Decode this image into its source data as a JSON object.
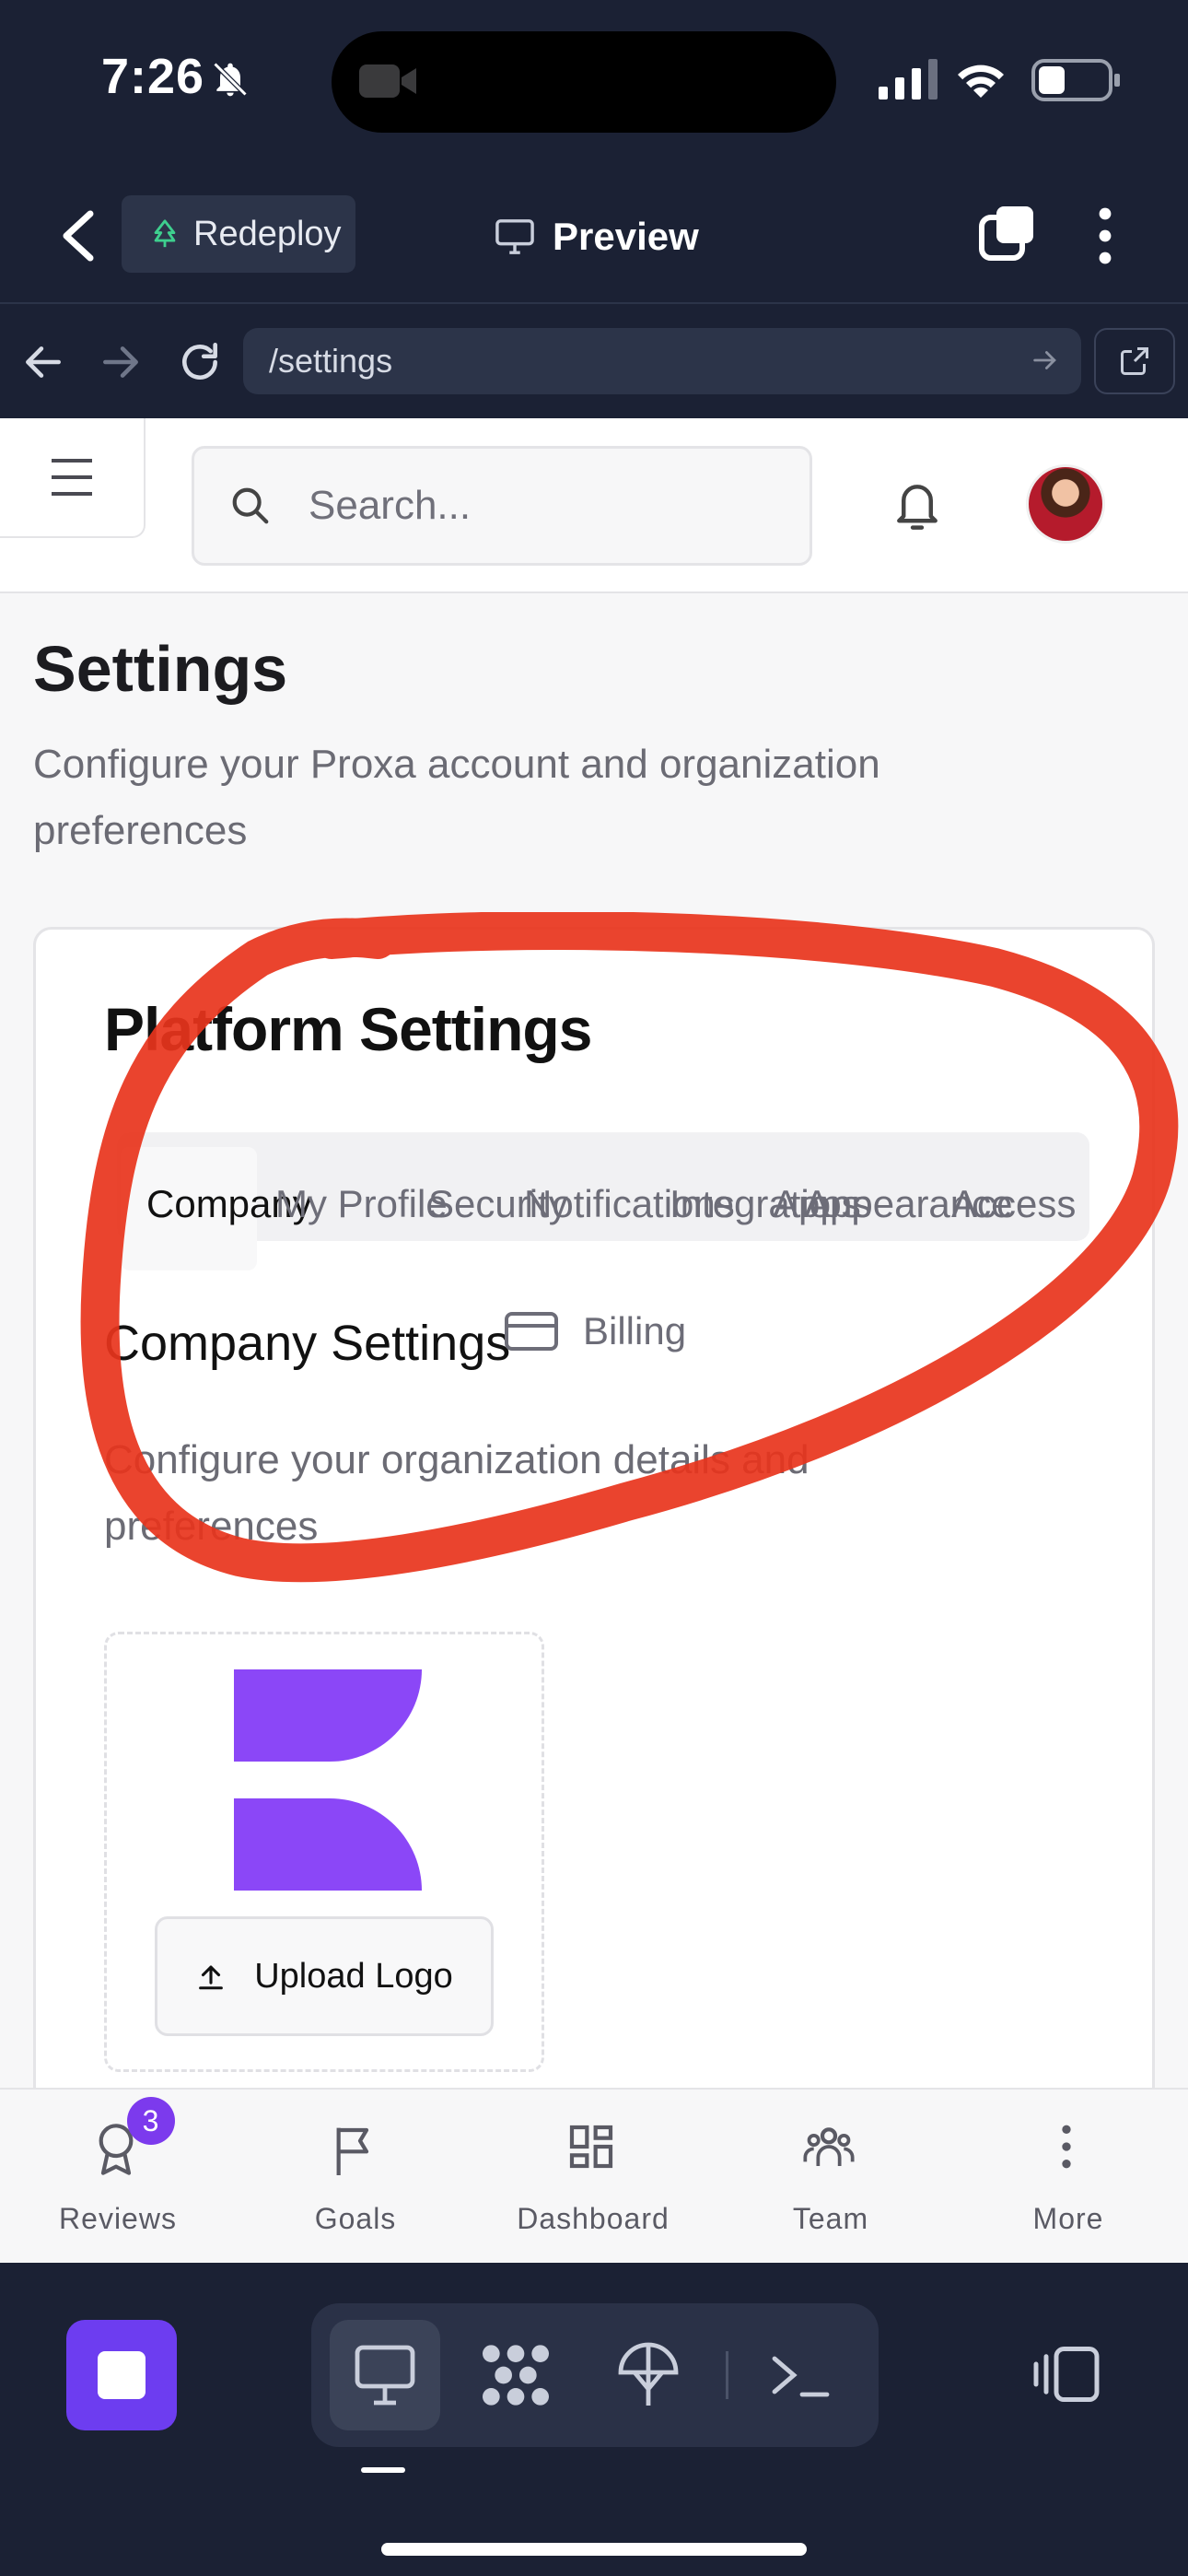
{
  "status_bar": {
    "time": "7:26"
  },
  "app_header": {
    "redeploy_label": "Redeploy",
    "preview_label": "Preview"
  },
  "browser": {
    "url": "/settings"
  },
  "topbar": {
    "search_placeholder": "Search..."
  },
  "page": {
    "title": "Settings",
    "subtitle": "Configure your Proxa account and organization preferences"
  },
  "card": {
    "title": "Platform Settings",
    "tabs": [
      {
        "label": "Company"
      },
      {
        "label": "My Profile"
      },
      {
        "label": "Security"
      },
      {
        "label": "Notifications"
      },
      {
        "label": "Integrations"
      },
      {
        "label": "Apps"
      },
      {
        "label": "Appearance"
      },
      {
        "label": "Access"
      }
    ],
    "billing_tab": "Billing",
    "section_title": "Company Settings",
    "section_subtitle": "Configure your organization details and preferences",
    "upload_label": "Upload Logo"
  },
  "annotation": {
    "color": "#e8341c"
  },
  "bottom_nav": {
    "items": [
      {
        "label": "Reviews",
        "icon": "award-icon",
        "badge": "3"
      },
      {
        "label": "Goals",
        "icon": "flag-icon"
      },
      {
        "label": "Dashboard",
        "icon": "dashboard-icon"
      },
      {
        "label": "Team",
        "icon": "team-icon"
      },
      {
        "label": "More",
        "icon": "more-vertical-icon"
      }
    ]
  },
  "colors": {
    "accent": "#7c3aed",
    "dark_bg": "#1b2134"
  }
}
